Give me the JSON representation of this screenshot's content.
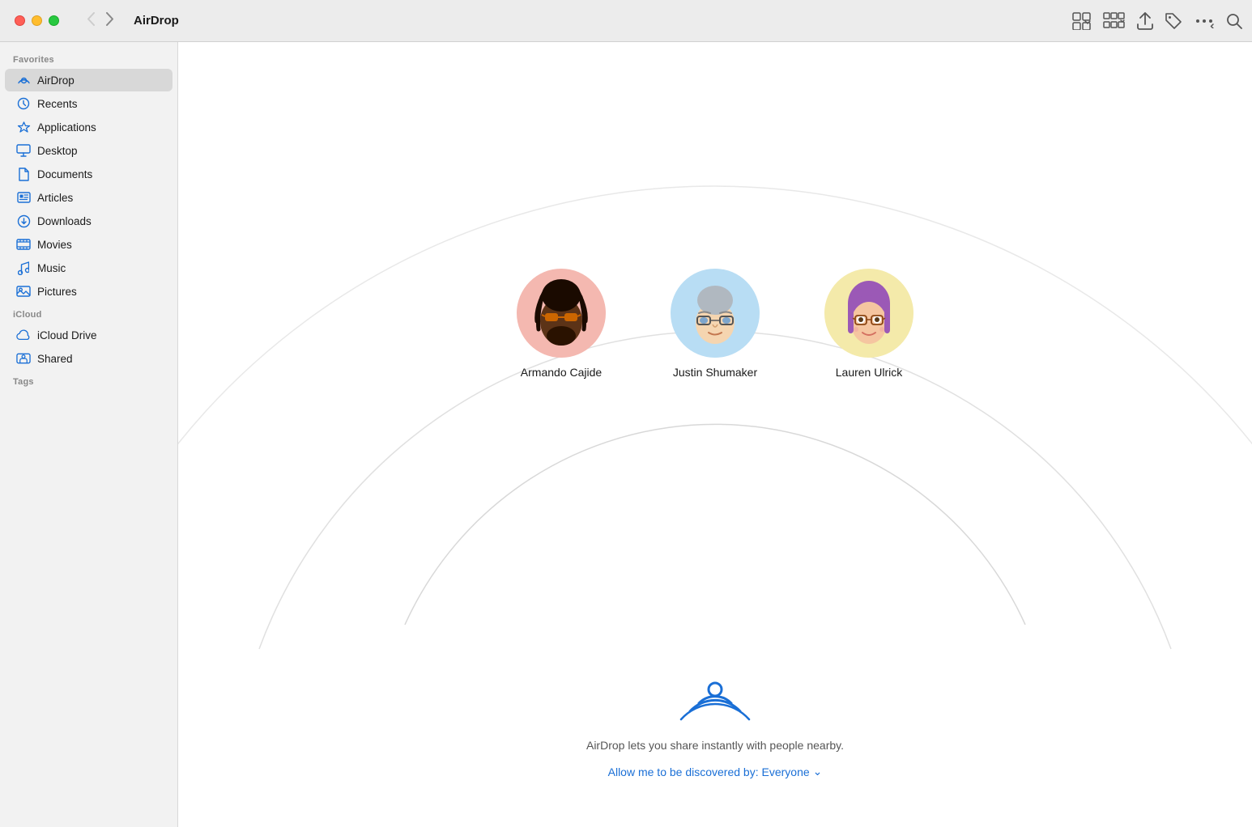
{
  "window": {
    "title": "AirDrop"
  },
  "toolbar": {
    "back_label": "‹",
    "forward_label": "›",
    "view_grid_label": "⊞",
    "view_group_label": "⊟",
    "share_label": "⬆",
    "tag_label": "◇",
    "more_label": "···",
    "search_label": "⌕"
  },
  "sidebar": {
    "favorites_label": "Favorites",
    "icloud_label": "iCloud",
    "tags_label": "Tags",
    "items": [
      {
        "id": "airdrop",
        "label": "AirDrop",
        "icon": "airdrop",
        "active": true
      },
      {
        "id": "recents",
        "label": "Recents",
        "icon": "recents",
        "active": false
      },
      {
        "id": "applications",
        "label": "Applications",
        "icon": "applications",
        "active": false
      },
      {
        "id": "desktop",
        "label": "Desktop",
        "icon": "desktop",
        "active": false
      },
      {
        "id": "documents",
        "label": "Documents",
        "icon": "documents",
        "active": false
      },
      {
        "id": "articles",
        "label": "Articles",
        "icon": "folder",
        "active": false
      },
      {
        "id": "downloads",
        "label": "Downloads",
        "icon": "downloads",
        "active": false
      },
      {
        "id": "movies",
        "label": "Movies",
        "icon": "movies",
        "active": false
      },
      {
        "id": "music",
        "label": "Music",
        "icon": "music",
        "active": false
      },
      {
        "id": "pictures",
        "label": "Pictures",
        "icon": "pictures",
        "active": false
      }
    ],
    "icloud_items": [
      {
        "id": "icloud-drive",
        "label": "iCloud Drive",
        "icon": "icloud",
        "active": false
      },
      {
        "id": "shared",
        "label": "Shared",
        "icon": "shared",
        "active": false
      }
    ]
  },
  "content": {
    "people": [
      {
        "id": "armando",
        "name": "Armando Cajide",
        "avatar_color": "#f4b8b0",
        "emoji": "🧑"
      },
      {
        "id": "justin",
        "name": "Justin Shumaker",
        "avatar_color": "#b8ddf4",
        "emoji": "👨"
      },
      {
        "id": "lauren",
        "name": "Lauren Ulrick",
        "avatar_color": "#f4eaaa",
        "emoji": "👩"
      }
    ],
    "description": "AirDrop lets you share instantly with people nearby.",
    "discovery_label": "Allow me to be discovered by: Everyone",
    "discovery_chevron": "⌄"
  }
}
